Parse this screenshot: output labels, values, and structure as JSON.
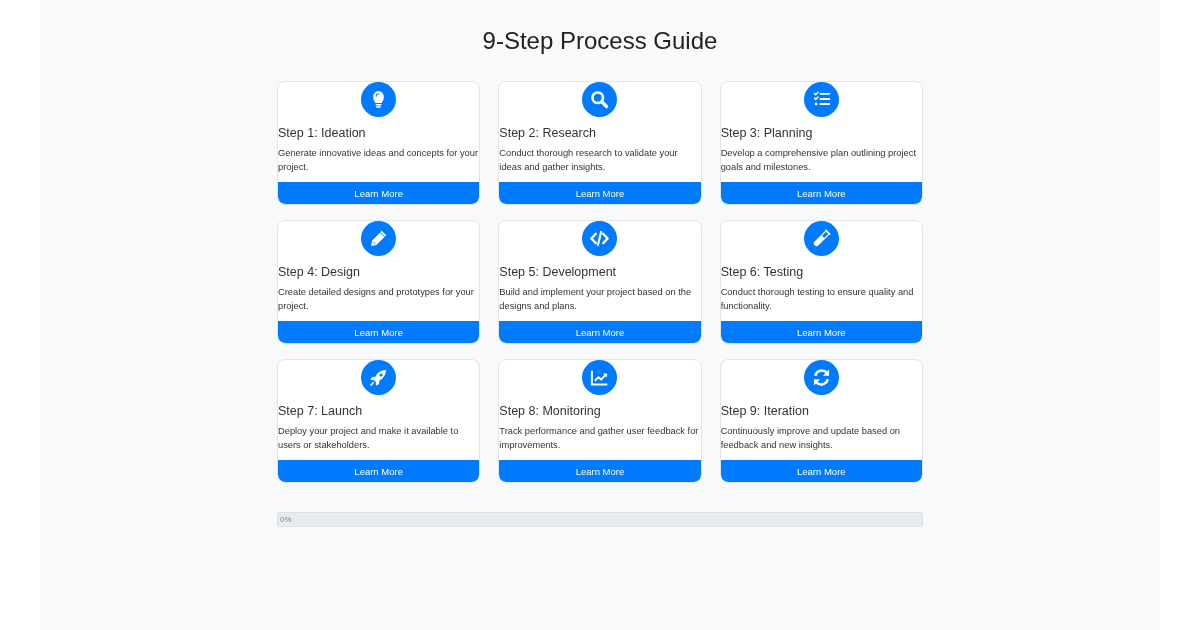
{
  "title": "9-Step Process Guide",
  "steps": [
    {
      "title": "Step 1: Ideation",
      "description": "Generate innovative ideas and concepts for your project.",
      "button": "Learn More"
    },
    {
      "title": "Step 2: Research",
      "description": "Conduct thorough research to validate your ideas and gather insights.",
      "button": "Learn More"
    },
    {
      "title": "Step 3: Planning",
      "description": "Develop a comprehensive plan outlining project goals and milestones.",
      "button": "Learn More"
    },
    {
      "title": "Step 4: Design",
      "description": "Create detailed designs and prototypes for your project.",
      "button": "Learn More"
    },
    {
      "title": "Step 5: Development",
      "description": "Build and implement your project based on the designs and plans.",
      "button": "Learn More"
    },
    {
      "title": "Step 6: Testing",
      "description": "Conduct thorough testing to ensure quality and functionality.",
      "button": "Learn More"
    },
    {
      "title": "Step 7: Launch",
      "description": "Deploy your project and make it available to users or stakeholders.",
      "button": "Learn More"
    },
    {
      "title": "Step 8: Monitoring",
      "description": "Track performance and gather user feedback for improvements.",
      "button": "Learn More"
    },
    {
      "title": "Step 9: Iteration",
      "description": "Continuously improve and update based on feedback and new insights.",
      "button": "Learn More"
    }
  ],
  "progress": {
    "level": 0,
    "reading": "0%"
  }
}
